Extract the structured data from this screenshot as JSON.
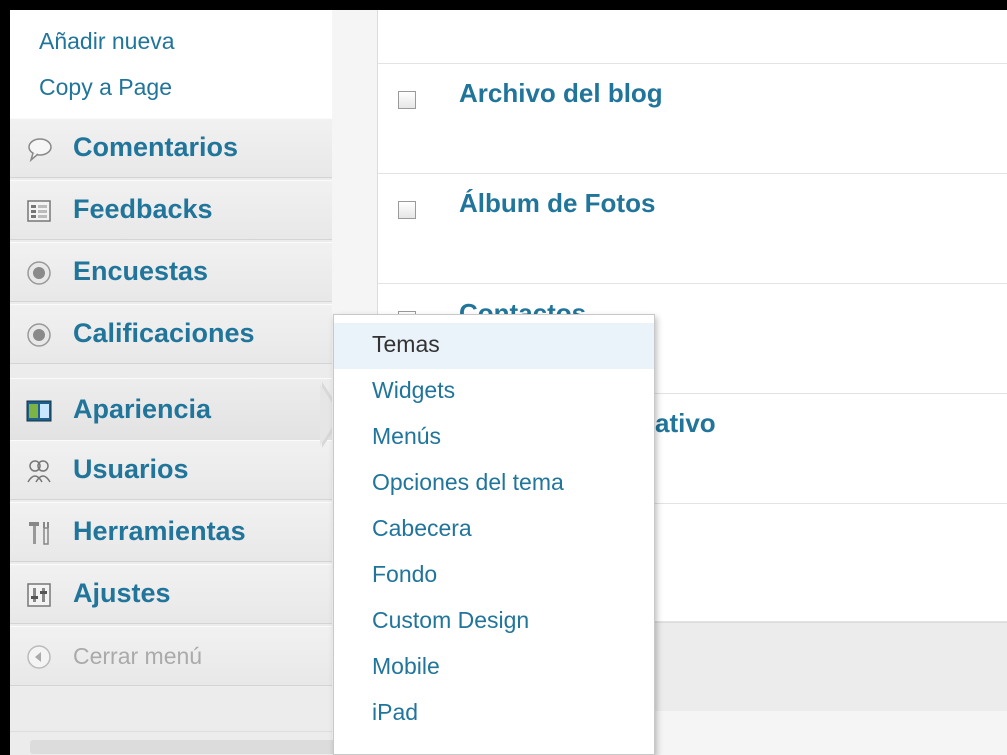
{
  "sidebar": {
    "submenu_links": [
      "Añadir nueva",
      "Copy a Page"
    ],
    "items": [
      {
        "label": "Comentarios",
        "icon": "speech-bubble-icon"
      },
      {
        "label": "Feedbacks",
        "icon": "form-icon"
      },
      {
        "label": "Encuestas",
        "icon": "poll-circle-icon"
      },
      {
        "label": "Calificaciones",
        "icon": "ratings-circle-icon"
      },
      {
        "label": "Apariencia",
        "icon": "appearance-icon"
      },
      {
        "label": "Usuarios",
        "icon": "users-icon"
      },
      {
        "label": "Herramientas",
        "icon": "tools-icon"
      },
      {
        "label": "Ajustes",
        "icon": "settings-icon"
      }
    ],
    "collapse_label": "Cerrar menú"
  },
  "pages": [
    {
      "title": "Archivo del blog"
    },
    {
      "title": "Álbum de Fotos"
    },
    {
      "title": "Contactos"
    },
    {
      "title": "ativo"
    }
  ],
  "flyout": {
    "items": [
      "Temas",
      "Widgets",
      "Menús",
      "Opciones del tema",
      "Cabecera",
      "Fondo",
      "Custom Design",
      "Mobile",
      "iPad"
    ]
  },
  "colors": {
    "link": "#21759b",
    "current_bg": "#eaf2fa"
  }
}
